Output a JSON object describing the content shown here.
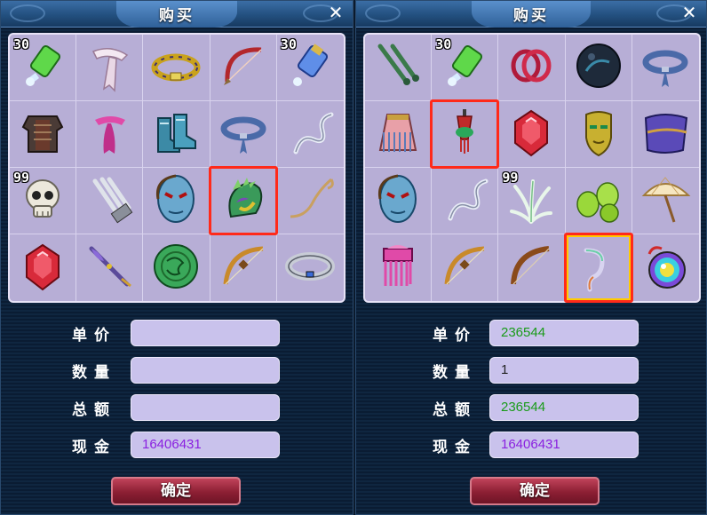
{
  "left": {
    "title": "购买",
    "close": "✕",
    "items": [
      {
        "icon": "green-bottle-icon",
        "qty": "30"
      },
      {
        "icon": "white-ribbon-icon",
        "qty": ""
      },
      {
        "icon": "gold-belt-icon",
        "qty": ""
      },
      {
        "icon": "red-bow-icon",
        "qty": ""
      },
      {
        "icon": "blue-bottle-icon",
        "qty": "30"
      },
      {
        "icon": "dark-armor-icon",
        "qty": ""
      },
      {
        "icon": "pink-ribbon-icon",
        "qty": ""
      },
      {
        "icon": "blue-boots-icon",
        "qty": ""
      },
      {
        "icon": "blue-belt-icon",
        "qty": ""
      },
      {
        "icon": "silver-whip-icon",
        "qty": ""
      },
      {
        "icon": "skull-icon",
        "qty": "99"
      },
      {
        "icon": "claw-blade-icon",
        "qty": ""
      },
      {
        "icon": "blue-mask-icon",
        "qty": ""
      },
      {
        "icon": "dragon-helmet-icon",
        "qty": ""
      },
      {
        "icon": "hook-whip-icon",
        "qty": ""
      },
      {
        "icon": "red-gem-icon",
        "qty": ""
      },
      {
        "icon": "purple-staff-icon",
        "qty": ""
      },
      {
        "icon": "jade-disc-icon",
        "qty": ""
      },
      {
        "icon": "gold-bow-icon",
        "qty": ""
      },
      {
        "icon": "silver-ring-icon",
        "qty": ""
      }
    ],
    "labels": {
      "price": "单价",
      "count": "数量",
      "total": "总额",
      "cash": "现金"
    },
    "values": {
      "price": "",
      "count": "",
      "total": "",
      "cash": "16406431"
    },
    "ok": "确定"
  },
  "right": {
    "title": "购买",
    "close": "✕",
    "items": [
      {
        "icon": "twin-dagger-icon",
        "qty": ""
      },
      {
        "icon": "green-bottle-icon",
        "qty": "30"
      },
      {
        "icon": "red-rings-icon",
        "qty": ""
      },
      {
        "icon": "dark-orb-icon",
        "qty": ""
      },
      {
        "icon": "blue-belt-icon",
        "qty": ""
      },
      {
        "icon": "fringe-skirt-icon",
        "qty": ""
      },
      {
        "icon": "tassel-charm-icon",
        "qty": ""
      },
      {
        "icon": "red-gem-icon",
        "qty": ""
      },
      {
        "icon": "gold-mask-icon",
        "qty": ""
      },
      {
        "icon": "purple-cloth-icon",
        "qty": ""
      },
      {
        "icon": "blue-mask-icon",
        "qty": ""
      },
      {
        "icon": "silver-whip-icon",
        "qty": ""
      },
      {
        "icon": "herb-leaves-icon",
        "qty": "99"
      },
      {
        "icon": "green-fruit-icon",
        "qty": ""
      },
      {
        "icon": "parasol-icon",
        "qty": ""
      },
      {
        "icon": "pink-comb-icon",
        "qty": ""
      },
      {
        "icon": "gold-bow-icon",
        "qty": ""
      },
      {
        "icon": "brown-bow-icon",
        "qty": ""
      },
      {
        "icon": "rainbow-whip-icon",
        "qty": ""
      },
      {
        "icon": "rainbow-mirror-icon",
        "qty": ""
      }
    ],
    "labels": {
      "price": "单价",
      "count": "数量",
      "total": "总额",
      "cash": "现金"
    },
    "values": {
      "price": "236544",
      "count": "1",
      "total": "236544",
      "cash": "16406431"
    },
    "ok": "确定"
  },
  "colors": {
    "selection_red": "#ff2a1a",
    "selection_gold": "#ffcc00",
    "value_green": "#1a9b1a",
    "cash_purple": "#8a20e0"
  }
}
